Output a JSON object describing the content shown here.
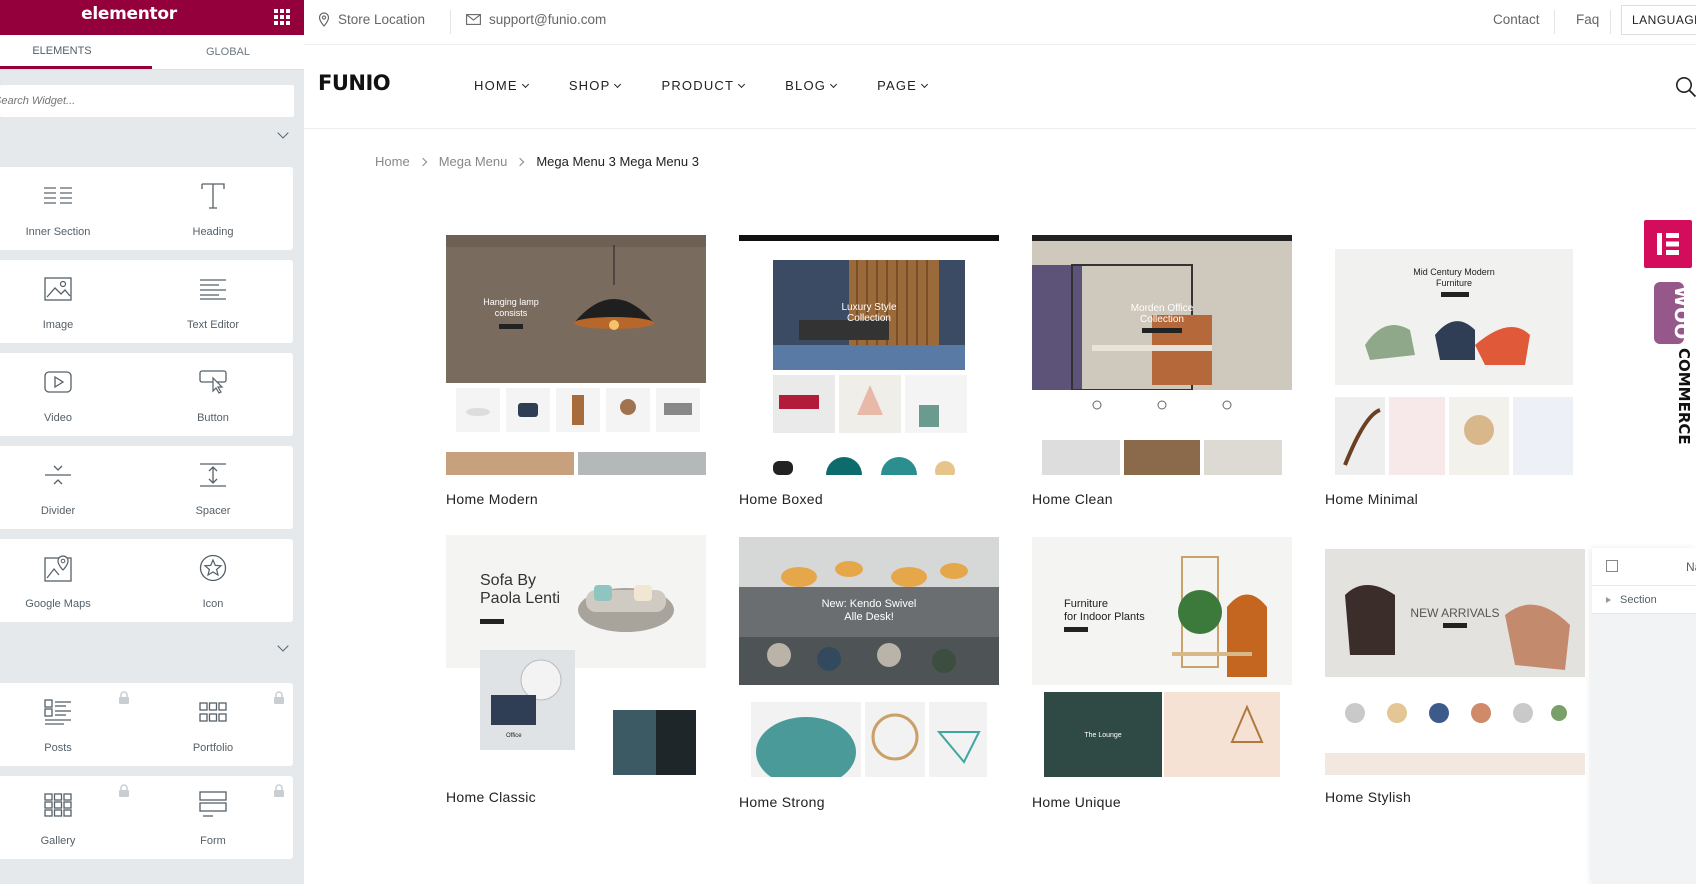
{
  "editor": {
    "brand": "elementor",
    "tabs": [
      "ELEMENTS",
      "GLOBAL"
    ],
    "search_placeholder": "Search Widget...",
    "widgets_basic": [
      {
        "label": "Inner Section",
        "icon": "inner-section-icon"
      },
      {
        "label": "Heading",
        "icon": "heading-icon"
      },
      {
        "label": "Image",
        "icon": "image-icon"
      },
      {
        "label": "Text Editor",
        "icon": "text-editor-icon"
      },
      {
        "label": "Video",
        "icon": "video-icon"
      },
      {
        "label": "Button",
        "icon": "button-icon"
      },
      {
        "label": "Divider",
        "icon": "divider-icon"
      },
      {
        "label": "Spacer",
        "icon": "spacer-icon"
      },
      {
        "label": "Google Maps",
        "icon": "google-maps-icon"
      },
      {
        "label": "Icon",
        "icon": "star-icon"
      }
    ],
    "widgets_pro": [
      {
        "label": "Posts",
        "icon": "posts-icon"
      },
      {
        "label": "Portfolio",
        "icon": "portfolio-icon"
      },
      {
        "label": "Gallery",
        "icon": "gallery-icon"
      },
      {
        "label": "Form",
        "icon": "form-icon"
      }
    ],
    "accent_color": "#93003c"
  },
  "site": {
    "topbar": {
      "store_location": "Store Location",
      "email": "support@funio.com",
      "contact": "Contact",
      "faq": "Faq",
      "language": "LANGUAGE"
    },
    "logo": "FUNIO",
    "menu": [
      "HOME",
      "SHOP",
      "PRODUCT",
      "BLOG",
      "PAGE"
    ],
    "breadcrumb": {
      "home": "Home",
      "mega_menu": "Mega Menu",
      "current": "Mega Menu 3 Mega Menu 3"
    },
    "demos": [
      {
        "title": "Home Modern",
        "hero_text": "Hanging lamp consists"
      },
      {
        "title": "Home Boxed",
        "hero_text": "Luxury Style Collection"
      },
      {
        "title": "Home Clean",
        "hero_text": "Morden Office Collection"
      },
      {
        "title": "Home Minimal",
        "hero_text": "Mid Century Modern Furniture"
      },
      {
        "title": "Home Classic",
        "hero_text": "Sofa By Paola Lenti"
      },
      {
        "title": "Home Strong",
        "hero_text": "New: Kendo Swivel Alle Desk!"
      },
      {
        "title": "Home Unique",
        "hero_text": "Furniture for Indoor Plants"
      },
      {
        "title": "Home Stylish",
        "hero_text": "NEW ARRIVALS"
      }
    ],
    "navigator": {
      "title": "Na",
      "row": "Section"
    },
    "woocommerce": "WOOCOMMERCE"
  }
}
